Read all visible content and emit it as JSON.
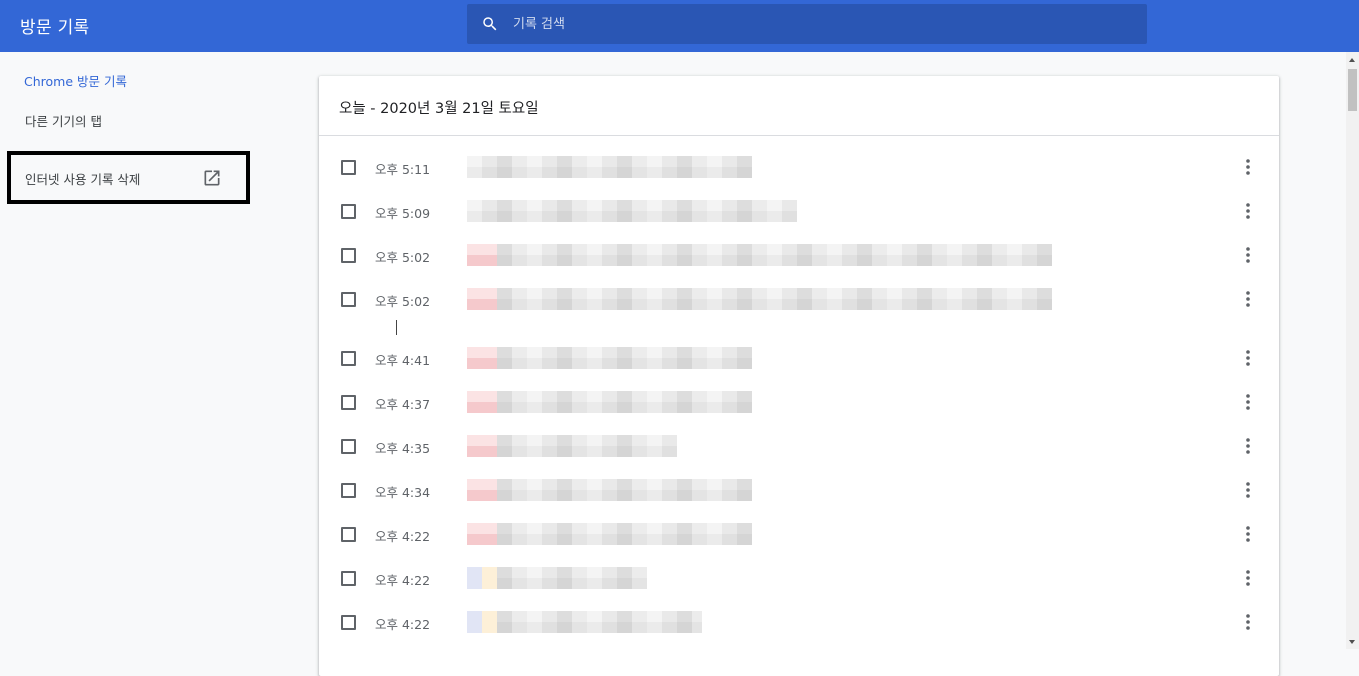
{
  "header": {
    "title": "방문 기록",
    "search_placeholder": "기록 검색"
  },
  "sidebar": {
    "items": [
      {
        "label": "Chrome 방문 기록",
        "active": true
      },
      {
        "label": "다른 기기의 탭",
        "active": false
      }
    ],
    "clear_data_label": "인터넷 사용 기록 삭제"
  },
  "history": {
    "date_header": "오늘 - 2020년 3월 21일 토요일",
    "entries": [
      {
        "time": "오후 5:11"
      },
      {
        "time": "오후 5:09"
      },
      {
        "time": "오후 5:02"
      },
      {
        "time": "오후 5:02"
      },
      {
        "time": "오후 4:41"
      },
      {
        "time": "오후 4:37"
      },
      {
        "time": "오후 4:35"
      },
      {
        "time": "오후 4:34"
      },
      {
        "time": "오후 4:22"
      },
      {
        "time": "오후 4:22"
      },
      {
        "time": "오후 4:22"
      }
    ]
  },
  "colors": {
    "header_bg": "#3367d6",
    "search_bg": "#2a56b4",
    "active_link": "#3367d6"
  },
  "icons": {
    "search": "search-icon",
    "external": "open-in-new-icon",
    "more": "more-vert-icon"
  }
}
